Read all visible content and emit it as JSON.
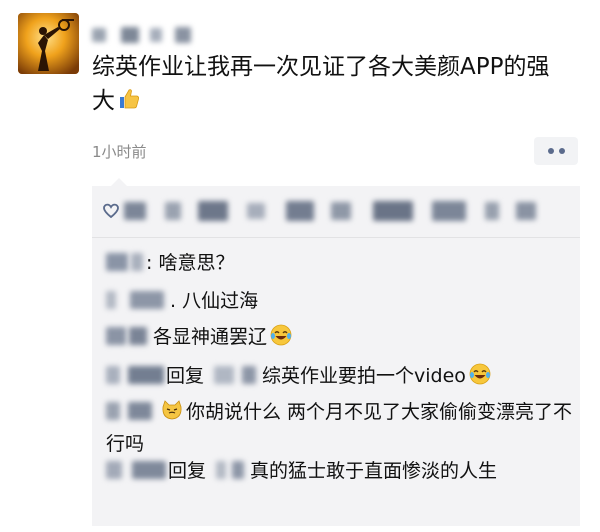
{
  "post": {
    "text": "综英作业让我再一次见证了各大美颜APP的强大",
    "time": "1小时前"
  },
  "comments": [
    {
      "text": ": 啥意思？"
    },
    {
      "text": ". 八仙过海"
    },
    {
      "text": "各显神通罢辽"
    },
    {
      "reply_word": "回复",
      "text": "综英作业要拍一个video"
    },
    {
      "text": "你胡说什么 两个月不见了大家偷偷变漂亮了不行吗"
    },
    {
      "reply_word": "回复",
      "text": "真的猛士敢于直面惨淡的人生"
    }
  ],
  "colors": {
    "avatar_bg": "#e38b18",
    "panel_bg": "#f3f3f5",
    "time_text": "#8a8a8a",
    "more_dots": "#5b6b8c"
  },
  "icons": [
    "avatar-image",
    "thumbs-up-icon",
    "more-dots-icon",
    "heart-icon",
    "laughing-emoji-icon",
    "cat-emoji-icon"
  ]
}
